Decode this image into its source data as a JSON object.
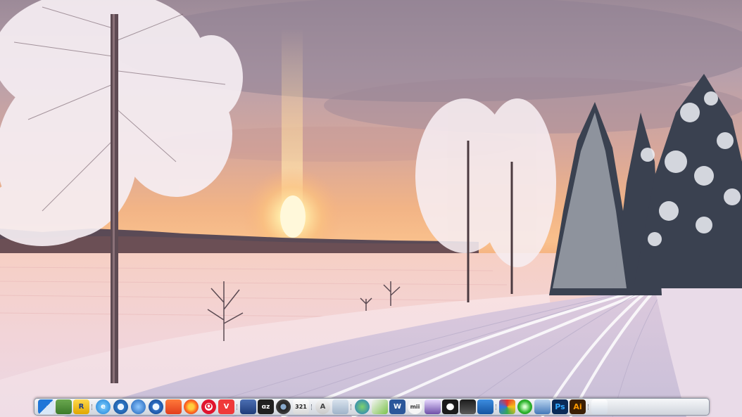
{
  "desktop": {
    "wallpaper": "winter-sunset-snow-road",
    "colors": {
      "sky_top": "#b9a1aa",
      "sky_glow": "#f6b783",
      "sun": "#fff6c8",
      "snow": "#f3dfe6"
    }
  },
  "dock": {
    "items": [
      {
        "name": "finder-icon",
        "label": ""
      },
      {
        "name": "notes-app-icon",
        "label": ""
      },
      {
        "name": "r-app-icon",
        "label": "R"
      },
      {
        "name": "internet-explorer-icon",
        "label": "e"
      },
      {
        "name": "safari-icon",
        "label": ""
      },
      {
        "name": "firefox-blue-icon",
        "label": ""
      },
      {
        "name": "thunderbird-icon",
        "label": ""
      },
      {
        "name": "brave-browser-icon",
        "label": ""
      },
      {
        "name": "firefox-icon",
        "label": ""
      },
      {
        "name": "opera-icon",
        "label": "O"
      },
      {
        "name": "vivaldi-icon",
        "label": "V"
      },
      {
        "name": "save-floppy-icon",
        "label": ""
      },
      {
        "name": "archive-utility-icon",
        "label": "ɑz"
      },
      {
        "name": "camera-app-icon",
        "label": ""
      },
      {
        "name": "calendar-321-icon",
        "label": "321"
      },
      {
        "name": "app-store-icon",
        "label": "A"
      },
      {
        "name": "magnifier-icon",
        "label": ""
      },
      {
        "name": "globe-icon",
        "label": ""
      },
      {
        "name": "paint-tool-icon",
        "label": ""
      },
      {
        "name": "word-icon",
        "label": "W"
      },
      {
        "name": "mii-icon",
        "label": "mii"
      },
      {
        "name": "brush-palette-icon",
        "label": ""
      },
      {
        "name": "eye-app-icon",
        "label": ""
      },
      {
        "name": "inkscape-icon",
        "label": ""
      },
      {
        "name": "shield-icon",
        "label": ""
      },
      {
        "name": "colorful-app-icon",
        "label": ""
      },
      {
        "name": "green-orb-icon",
        "label": ""
      },
      {
        "name": "shield-blue-icon",
        "label": ""
      },
      {
        "name": "photoshop-icon",
        "label": "Ps"
      },
      {
        "name": "illustrator-icon",
        "label": "Ai"
      },
      {
        "name": "document-icon",
        "label": ""
      }
    ]
  }
}
